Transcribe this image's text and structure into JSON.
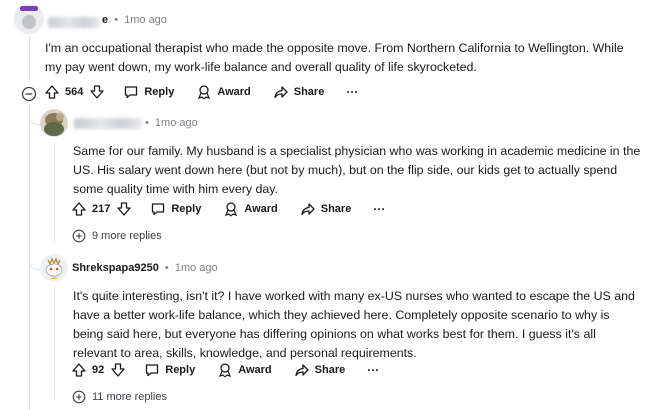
{
  "comments": [
    {
      "time": "1mo ago",
      "blurred_name_suffix": "e",
      "text": "I'm an occupational therapist who made the opposite move. From Northern California to Wellington. While my pay went down, my work-life balance and overall quality of life skyrocketed.",
      "votes": "564",
      "reply_label": "Reply",
      "award_label": "Award",
      "share_label": "Share",
      "more_label": "···"
    },
    {
      "time": "1mo ago",
      "text": "Same for our family. My husband is a specialist physician who was working in academic medicine in the US. His salary went down here (but not by much), but on the flip side, our kids get to actually spend some quality time with him every day.",
      "votes": "217",
      "reply_label": "Reply",
      "award_label": "Award",
      "share_label": "Share",
      "more_label": "···",
      "more_replies": "9 more replies"
    },
    {
      "author": "Shrekspapa9250",
      "time": "1mo ago",
      "text": "It's quite interesting, isn't it? I have worked with many ex-US nurses who wanted to escape the US and have a better work-life balance, which they achieved here. Completely opposite scenario to why is being said here, but everyone has differing opinions on what works best for them. I guess it's all relevant to area, skills, knowledge, and personal requirements.",
      "votes": "92",
      "reply_label": "Reply",
      "award_label": "Award",
      "share_label": "Share",
      "more_label": "···",
      "more_replies": "11 more replies"
    }
  ],
  "separator": "•",
  "colors": {
    "meta": "#7c7f84",
    "line": "#e3e5e8",
    "text": "#1a1a1b"
  }
}
